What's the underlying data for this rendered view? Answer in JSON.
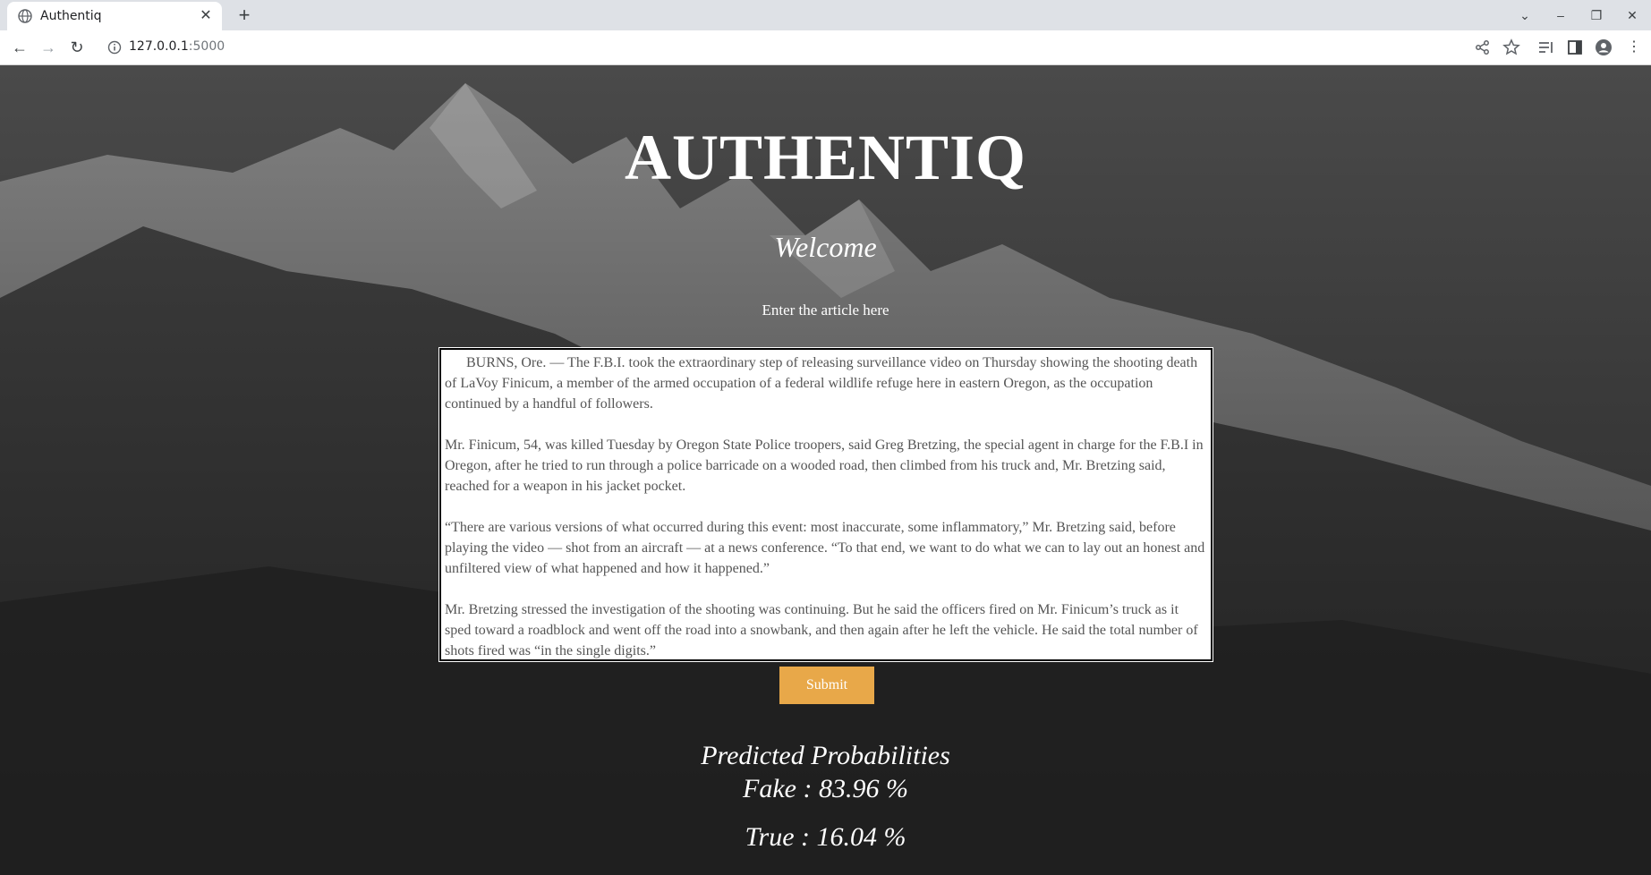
{
  "browser": {
    "tab_title": "Authentiq",
    "url_host": "127.0.0.1",
    "url_port": ":5000",
    "icons": [
      "globe-icon",
      "close-icon",
      "plus-icon",
      "back-icon",
      "forward-icon",
      "reload-icon",
      "info-icon",
      "share-icon",
      "star-icon",
      "reading-list-icon",
      "side-panel-icon",
      "profile-icon",
      "menu-icon"
    ]
  },
  "page": {
    "brand": "AUTHENTIQ",
    "welcome": "Welcome",
    "input_label": "Enter the article here",
    "article_text": "      BURNS, Ore. — The F.B.I. took the extraordinary step of releasing surveillance video on Thursday showing the shooting death of LaVoy Finicum, a member of the armed occupation of a federal wildlife refuge here in eastern Oregon, as the occupation continued by a handful of followers.\n\nMr. Finicum, 54, was killed Tuesday by Oregon State Police troopers, said Greg Bretzing, the special agent in charge for the F.B.I in Oregon, after he tried to run through a police barricade on a wooded road, then climbed from his truck and, Mr. Bretzing said, reached for a weapon in his jacket pocket.\n\n“There are various versions of what occurred during this event: most inaccurate, some inflammatory,” Mr. Bretzing said, before playing the video — shot from an aircraft — at a news conference. “To that end, we want to do what we can to lay out an honest and unfiltered view of what happened and how it happened.”\n\nMr. Bretzing stressed the investigation of the shooting was continuing. But he said the officers fired on Mr. Finicum’s truck as it sped toward a roadblock and went off the road into a snowbank, and then again after he left the vehicle. He said the total number of shots fired was “in the single digits.”",
    "submit_label": "Submit",
    "predictions": {
      "title": "Predicted Probabilities",
      "fake": "Fake : 83.96 %",
      "true": "True : 16.04 %"
    }
  },
  "colors": {
    "accent": "#e8a849",
    "text": "#ffffff",
    "chrome": "#dee1e6"
  }
}
